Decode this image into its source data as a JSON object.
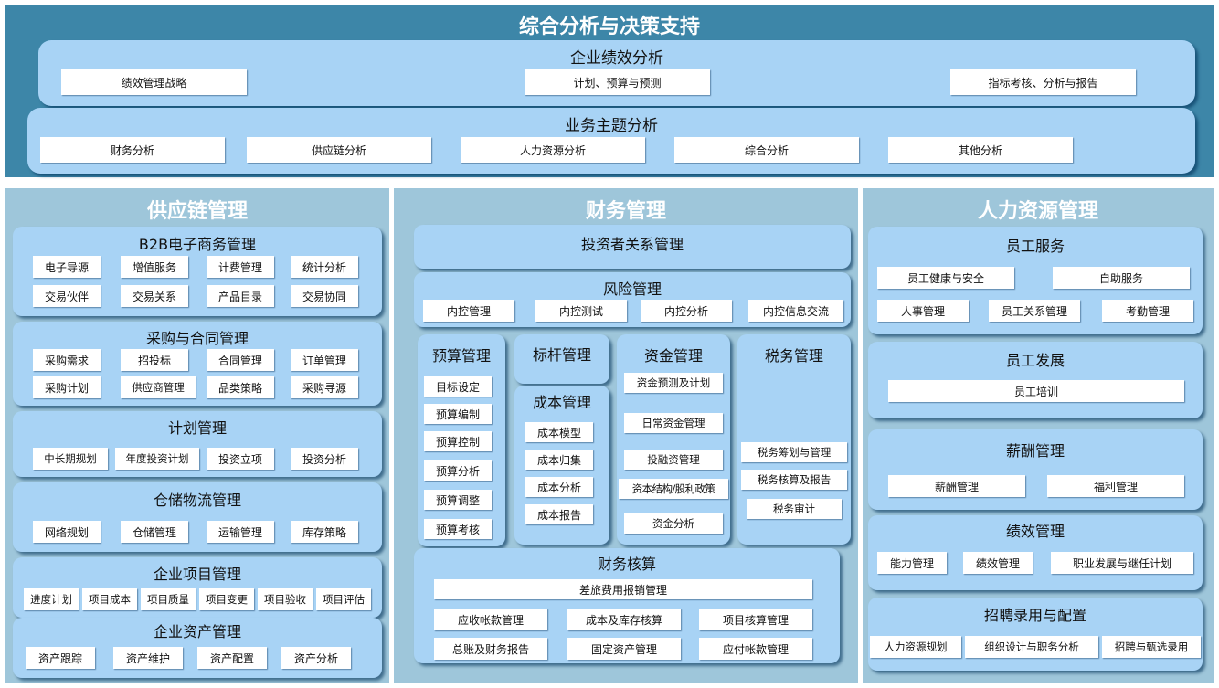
{
  "top": {
    "title": "综合分析与决策支持",
    "performance": {
      "title": "企业绩效分析",
      "items": [
        "绩效管理战略",
        "计划、预算与预测",
        "指标考核、分析与报告"
      ]
    },
    "business": {
      "title": "业务主题分析",
      "items": [
        "财务分析",
        "供应链分析",
        "人力资源分析",
        "综合分析",
        "其他分析"
      ]
    }
  },
  "scm": {
    "title": "供应链管理",
    "b2b": {
      "title": "B2B电子商务管理",
      "items": [
        "电子导源",
        "增值服务",
        "计费管理",
        "统计分析",
        "交易伙伴",
        "交易关系",
        "产品目录",
        "交易协同"
      ]
    },
    "procurement": {
      "title": "采购与合同管理",
      "items": [
        "采购需求",
        "招投标",
        "合同管理",
        "订单管理",
        "采购计划",
        "供应商管理",
        "品类策略",
        "采购寻源"
      ]
    },
    "planning": {
      "title": "计划管理",
      "items": [
        "中长期规划",
        "年度投资计划",
        "投资立项",
        "投资分析"
      ]
    },
    "warehouse": {
      "title": "仓储物流管理",
      "items": [
        "网络规划",
        "仓储管理",
        "运输管理",
        "库存策略"
      ]
    },
    "project": {
      "title": "企业项目管理",
      "items": [
        "进度计划",
        "项目成本",
        "项目质量",
        "项目变更",
        "项目验收",
        "项目评估"
      ]
    },
    "asset": {
      "title": "企业资产管理",
      "items": [
        "资产跟踪",
        "资产维护",
        "资产配置",
        "资产分析"
      ]
    }
  },
  "finance": {
    "title": "财务管理",
    "investor": {
      "title": "投资者关系管理"
    },
    "risk": {
      "title": "风险管理",
      "items": [
        "内控管理",
        "内控测试",
        "内控分析",
        "内控信息交流"
      ]
    },
    "budget": {
      "title": "预算管理",
      "items": [
        "目标设定",
        "预算编制",
        "预算控制",
        "预算分析",
        "预算调整",
        "预算考核"
      ]
    },
    "benchmark": {
      "title": "标杆管理"
    },
    "cost": {
      "title": "成本管理",
      "items": [
        "成本模型",
        "成本归集",
        "成本分析",
        "成本报告"
      ]
    },
    "fund": {
      "title": "资金管理",
      "items": [
        "资金预测及计划",
        "日常资金管理",
        "投融资管理",
        "资本结构/股利政策",
        "资金分析"
      ]
    },
    "tax": {
      "title": "税务管理",
      "items": [
        "税务筹划与管理",
        "税务核算及报告",
        "税务审计"
      ]
    },
    "accounting": {
      "title": "财务核算",
      "items": [
        "差旅费用报销管理",
        "应收帐款管理",
        "成本及库存核算",
        "项目核算管理",
        "总账及财务报告",
        "固定资产管理",
        "应付帐款管理"
      ]
    }
  },
  "hr": {
    "title": "人力资源管理",
    "service": {
      "title": "员工服务",
      "items": [
        "员工健康与安全",
        "自助服务",
        "人事管理",
        "员工关系管理",
        "考勤管理"
      ]
    },
    "development": {
      "title": "员工发展",
      "items": [
        "员工培训"
      ]
    },
    "compensation": {
      "title": "薪酬管理",
      "items": [
        "薪酬管理",
        "福利管理"
      ]
    },
    "performance": {
      "title": "绩效管理",
      "items": [
        "能力管理",
        "绩效管理",
        "职业发展与继任计划"
      ]
    },
    "recruit": {
      "title": "招聘录用与配置",
      "items": [
        "人力资源规划",
        "组织设计与职务分析",
        "招聘与甄选录用"
      ]
    }
  }
}
